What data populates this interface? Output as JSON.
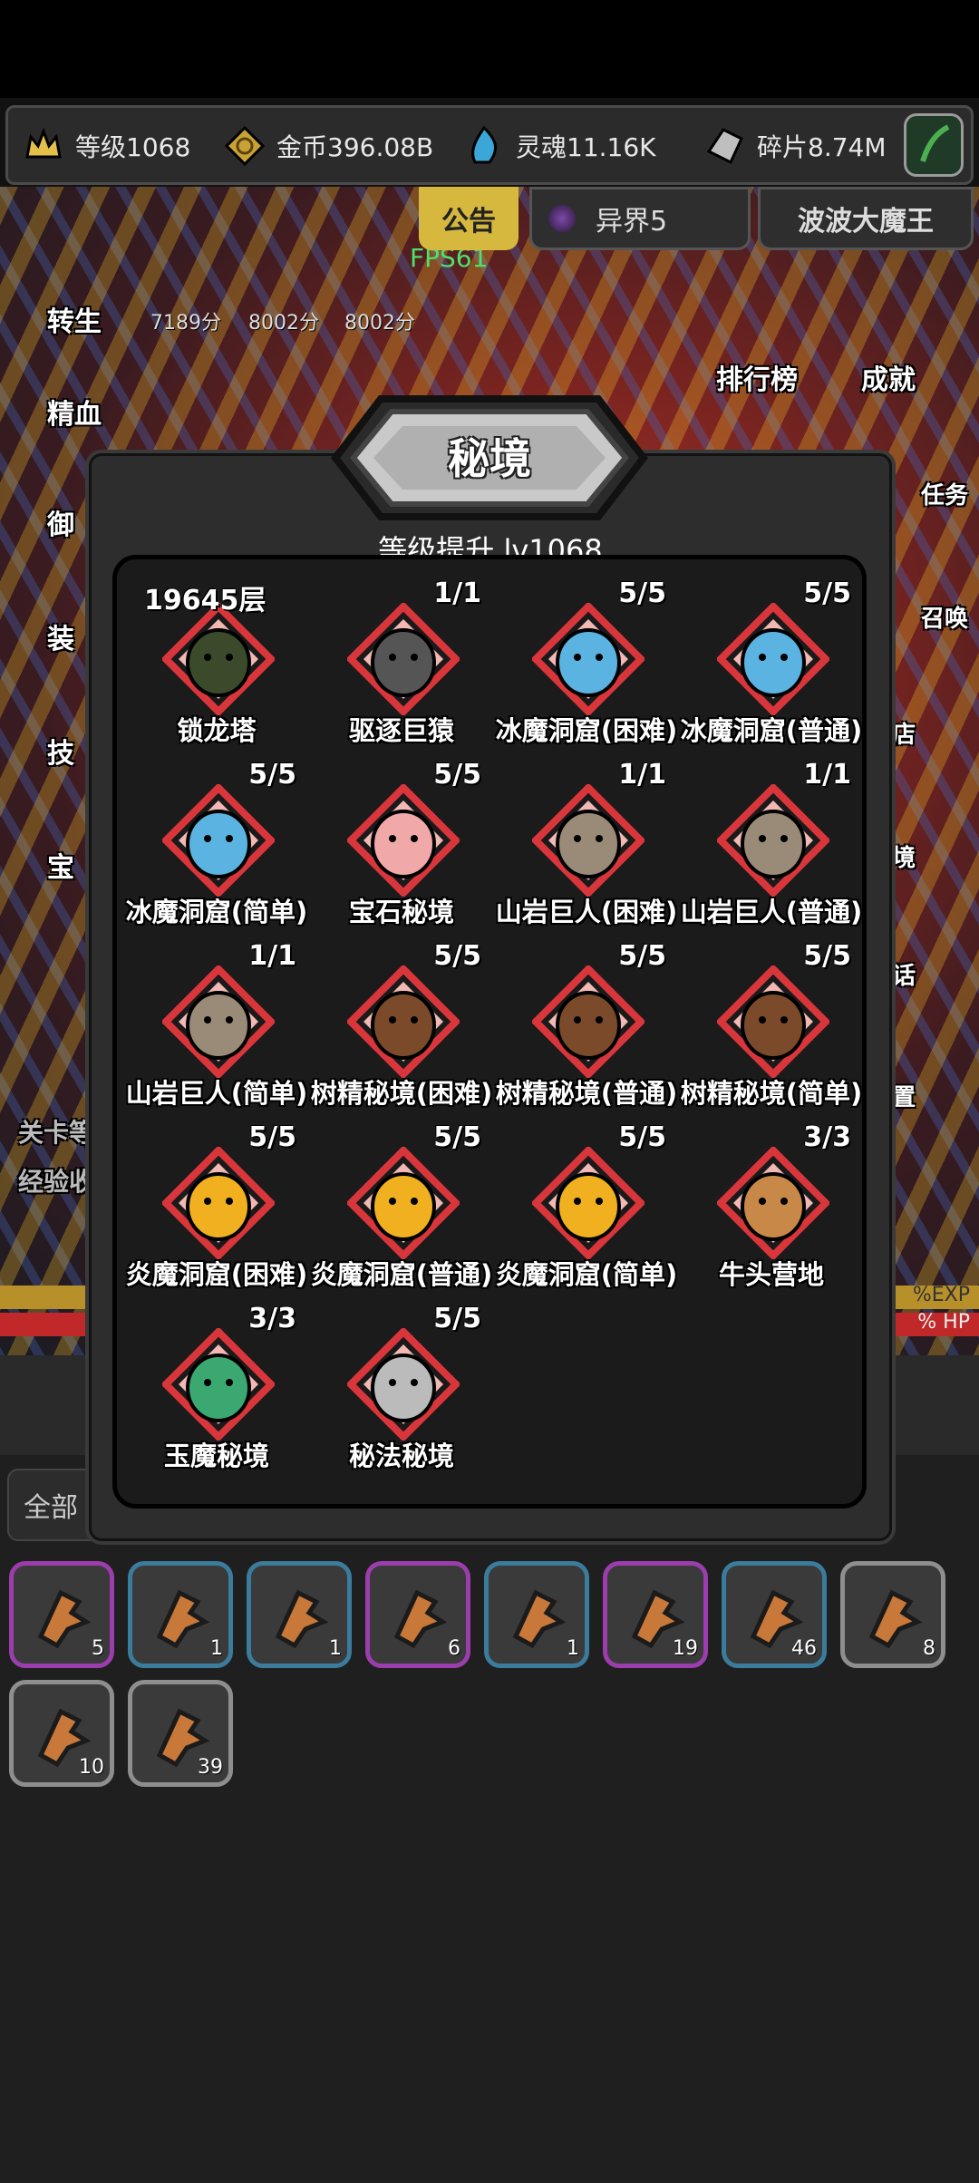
{
  "resources": [
    {
      "icon": "crown-icon",
      "label": "等级1068"
    },
    {
      "icon": "coin-icon",
      "label": "金币396.08B"
    },
    {
      "icon": "soul-icon",
      "label": "灵魂11.16K"
    },
    {
      "icon": "shard-icon",
      "label": "碎片8.74M"
    }
  ],
  "top_tabs": {
    "notice": "公告",
    "otherworld": "异界5",
    "boss": "波波大魔王"
  },
  "fps": "FPS61",
  "scores": [
    "7189分",
    "8002分",
    "8002分"
  ],
  "side_left": [
    "转生",
    "精血",
    "御",
    "装",
    "技",
    "宝"
  ],
  "side_right": {
    "ranking": "排行榜",
    "achievement": "成就",
    "task": "任务",
    "summon": "召唤",
    "shop": "店",
    "realm": "境",
    "talk": "话",
    "settings": "置"
  },
  "stage_partial": {
    "line1": "关卡等",
    "line2": "经验收"
  },
  "exp_bar": {
    "label": "%EXP",
    "color": "#b8902a"
  },
  "hp_bar": {
    "label": "% HP",
    "color": "#c0282a"
  },
  "filter": {
    "label": "全部"
  },
  "modal": {
    "title": "秘境",
    "subtitle": "等级提升 lv1068",
    "items": [
      {
        "name": "锁龙塔",
        "count": "19645层",
        "icon": "dragon-head-icon",
        "color": "#3a4a2a"
      },
      {
        "name": "驱逐巨猿",
        "count": "1/1",
        "icon": "ape-icon",
        "color": "#555555"
      },
      {
        "name": "冰魔洞窟(困难)",
        "count": "5/5",
        "icon": "ice-demon-icon",
        "color": "#5ab3e0"
      },
      {
        "name": "冰魔洞窟(普通)",
        "count": "5/5",
        "icon": "ice-demon-icon",
        "color": "#5ab3e0"
      },
      {
        "name": "冰魔洞窟(简单)",
        "count": "5/5",
        "icon": "ice-demon-icon",
        "color": "#5ab3e0"
      },
      {
        "name": "宝石秘境",
        "count": "5/5",
        "icon": "gem-icon",
        "color": "#f0a8a8"
      },
      {
        "name": "山岩巨人(困难)",
        "count": "1/1",
        "icon": "rock-giant-icon",
        "color": "#9a8a78"
      },
      {
        "name": "山岩巨人(普通)",
        "count": "1/1",
        "icon": "rock-giant-icon",
        "color": "#9a8a78"
      },
      {
        "name": "山岩巨人(简单)",
        "count": "1/1",
        "icon": "rock-giant-icon",
        "color": "#9a8a78"
      },
      {
        "name": "树精秘境(困难)",
        "count": "5/5",
        "icon": "treant-icon",
        "color": "#7a4a2a"
      },
      {
        "name": "树精秘境(普通)",
        "count": "5/5",
        "icon": "treant-icon",
        "color": "#7a4a2a"
      },
      {
        "name": "树精秘境(简单)",
        "count": "5/5",
        "icon": "treant-icon",
        "color": "#7a4a2a"
      },
      {
        "name": "炎魔洞窟(困难)",
        "count": "5/5",
        "icon": "fire-demon-icon",
        "color": "#f0b020"
      },
      {
        "name": "炎魔洞窟(普通)",
        "count": "5/5",
        "icon": "fire-demon-icon",
        "color": "#f0b020"
      },
      {
        "name": "炎魔洞窟(简单)",
        "count": "5/5",
        "icon": "fire-demon-icon",
        "color": "#f0b020"
      },
      {
        "name": "牛头营地",
        "count": "3/3",
        "icon": "minotaur-icon",
        "color": "#c88848"
      },
      {
        "name": "玉魔秘境",
        "count": "3/3",
        "icon": "jade-demon-icon",
        "color": "#3aa870"
      },
      {
        "name": "秘法秘境",
        "count": "5/5",
        "icon": "spellbook-icon",
        "color": "#bbbbbb"
      }
    ]
  },
  "inventory": [
    {
      "qty": "5",
      "border": "#9b3dac"
    },
    {
      "qty": "1",
      "border": "#3b7c9c"
    },
    {
      "qty": "1",
      "border": "#3b7c9c"
    },
    {
      "qty": "6",
      "border": "#9b3dac"
    },
    {
      "qty": "1",
      "border": "#3b7c9c"
    },
    {
      "qty": "19",
      "border": "#9b3dac"
    },
    {
      "qty": "46",
      "border": "#3b7c9c"
    },
    {
      "qty": "8",
      "border": "#8e8e8e"
    },
    {
      "qty": "10",
      "border": "#8e8e8e"
    },
    {
      "qty": "39",
      "border": "#8e8e8e"
    }
  ]
}
